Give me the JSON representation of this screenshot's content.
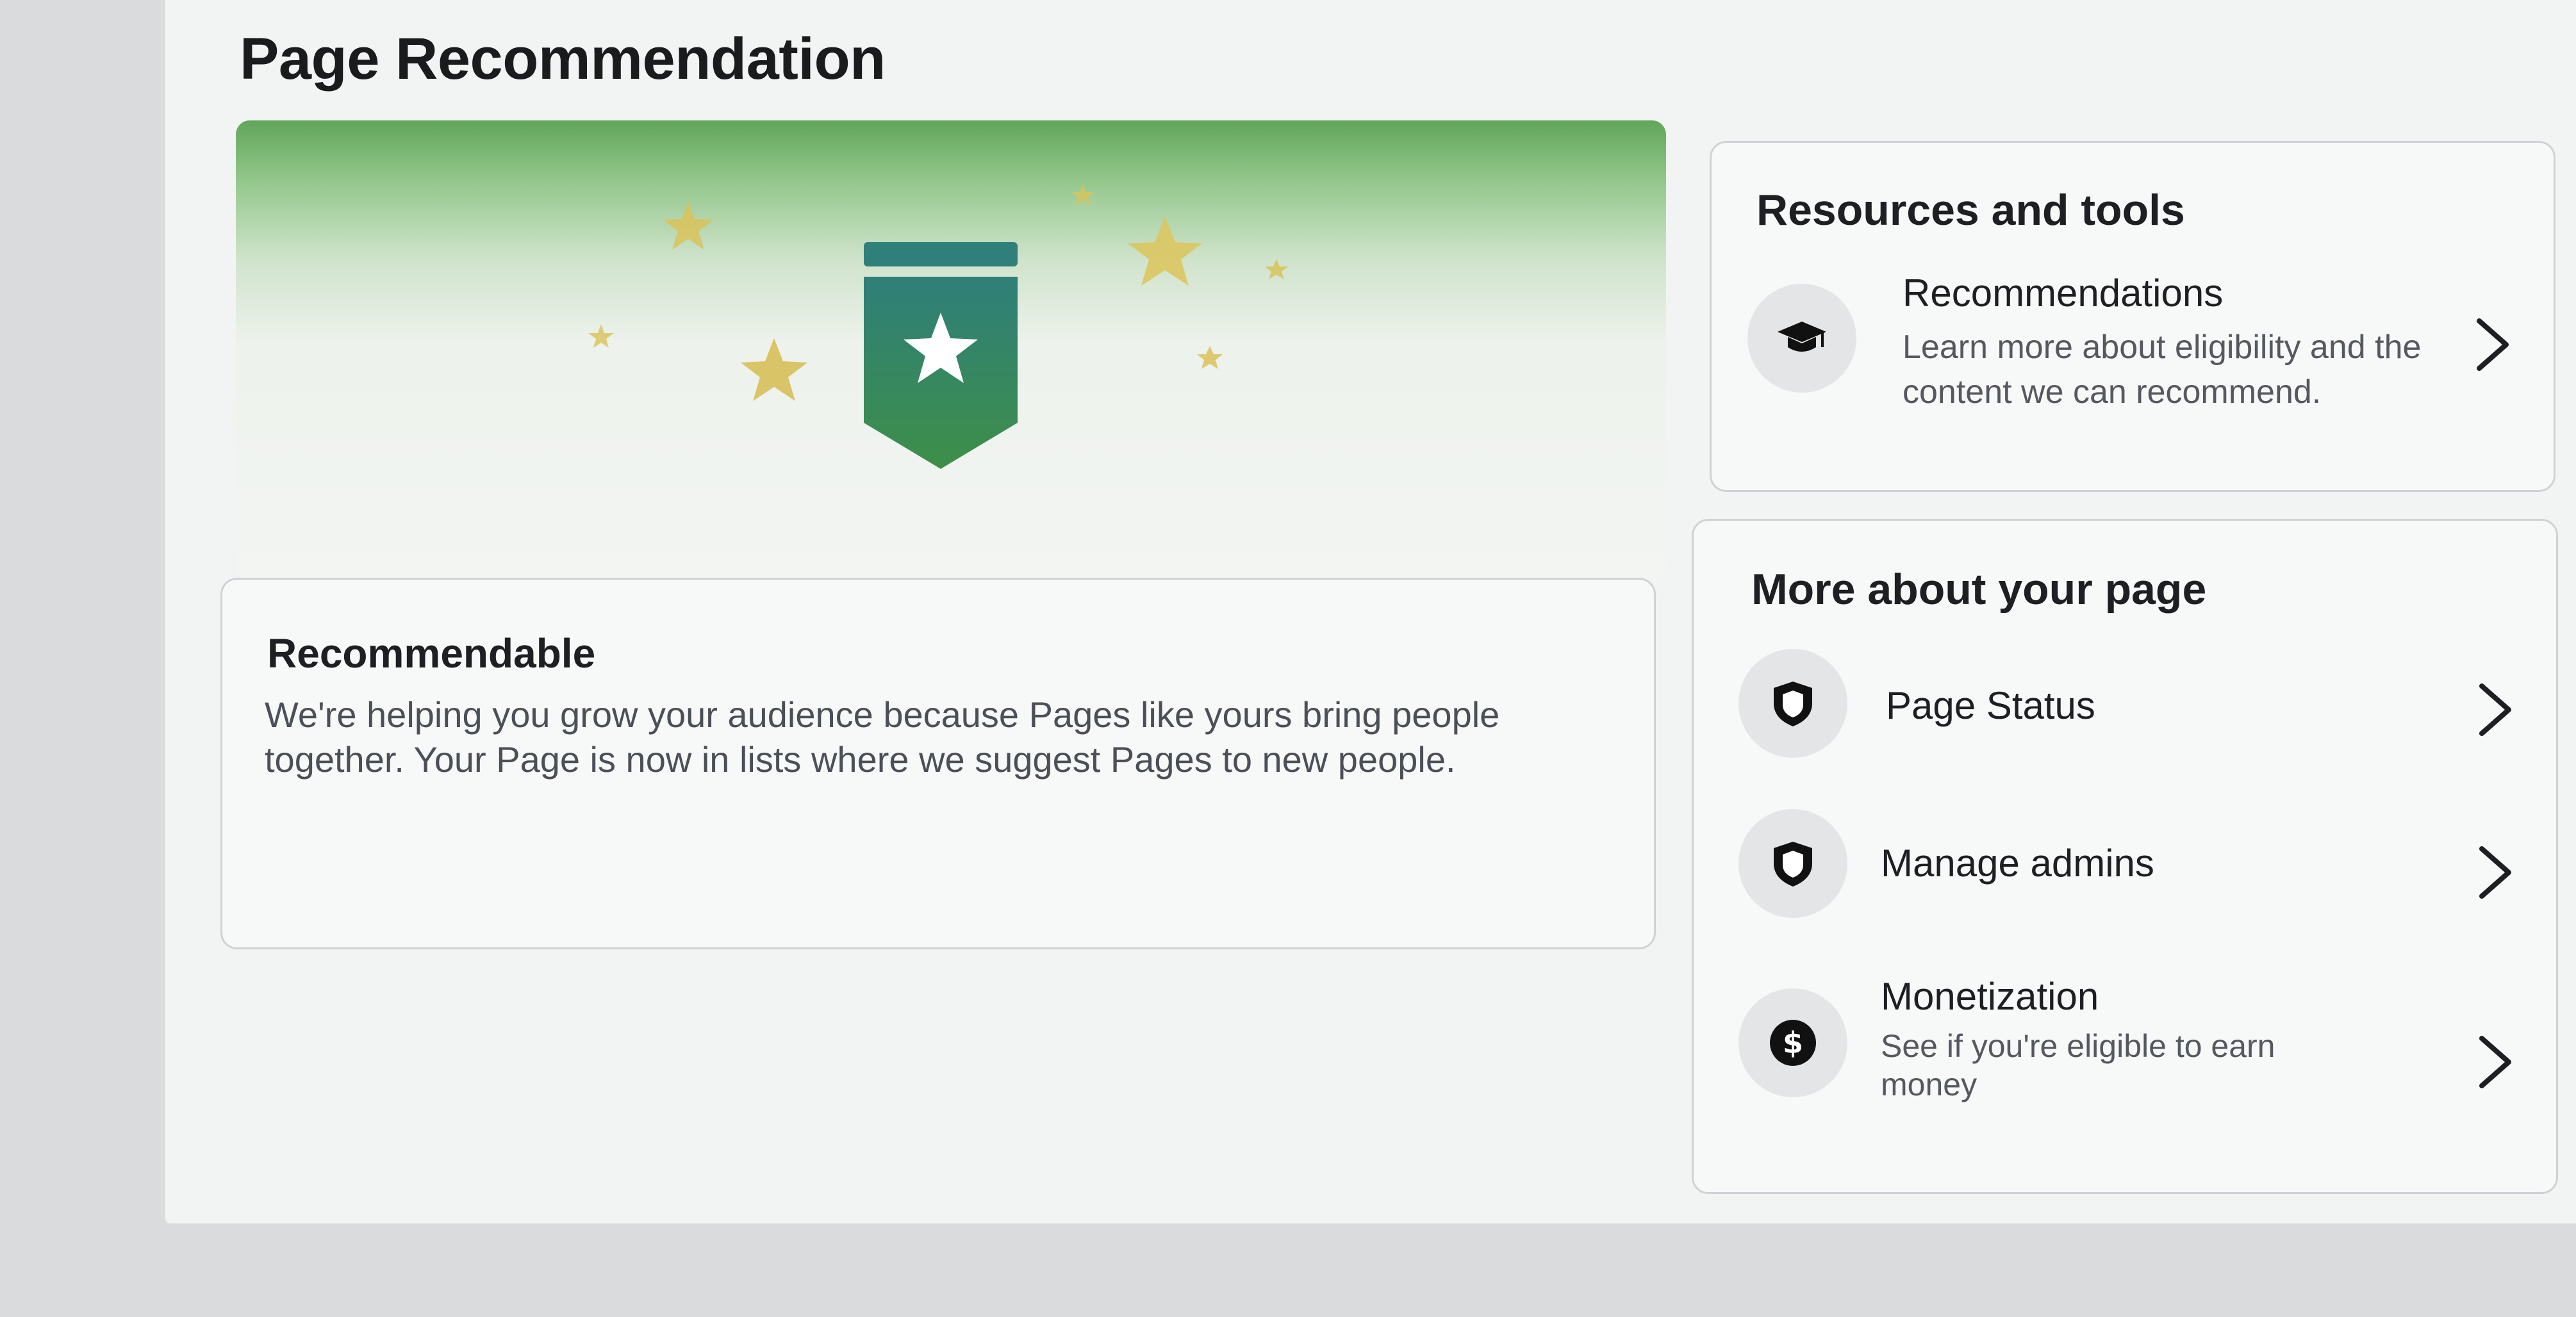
{
  "page": {
    "title": "Page Recommendation"
  },
  "status_card": {
    "title": "Recommendable",
    "description": "We're helping you grow your audience because Pages like yours bring people together. Your Page is now in lists where we suggest Pages to new people."
  },
  "resources": {
    "title": "Resources and tools",
    "items": [
      {
        "label": "Recommendations",
        "description": "Learn more about eligibility and the content we can recommend.",
        "icon": "graduation-cap-icon"
      }
    ]
  },
  "more_about": {
    "title": "More about your page",
    "items": [
      {
        "label": "Page Status",
        "icon": "shield-icon"
      },
      {
        "label": "Manage admins",
        "icon": "shield-icon"
      },
      {
        "label": "Monetization",
        "description": "See if you're eligible to earn money",
        "icon": "dollar-icon"
      }
    ]
  },
  "colors": {
    "banner_green": "#3f8a4a",
    "banner_teal": "#2f7f7a",
    "star_gold": "#d9c35a",
    "text_primary": "#1d1f22",
    "text_secondary": "#55595f"
  }
}
